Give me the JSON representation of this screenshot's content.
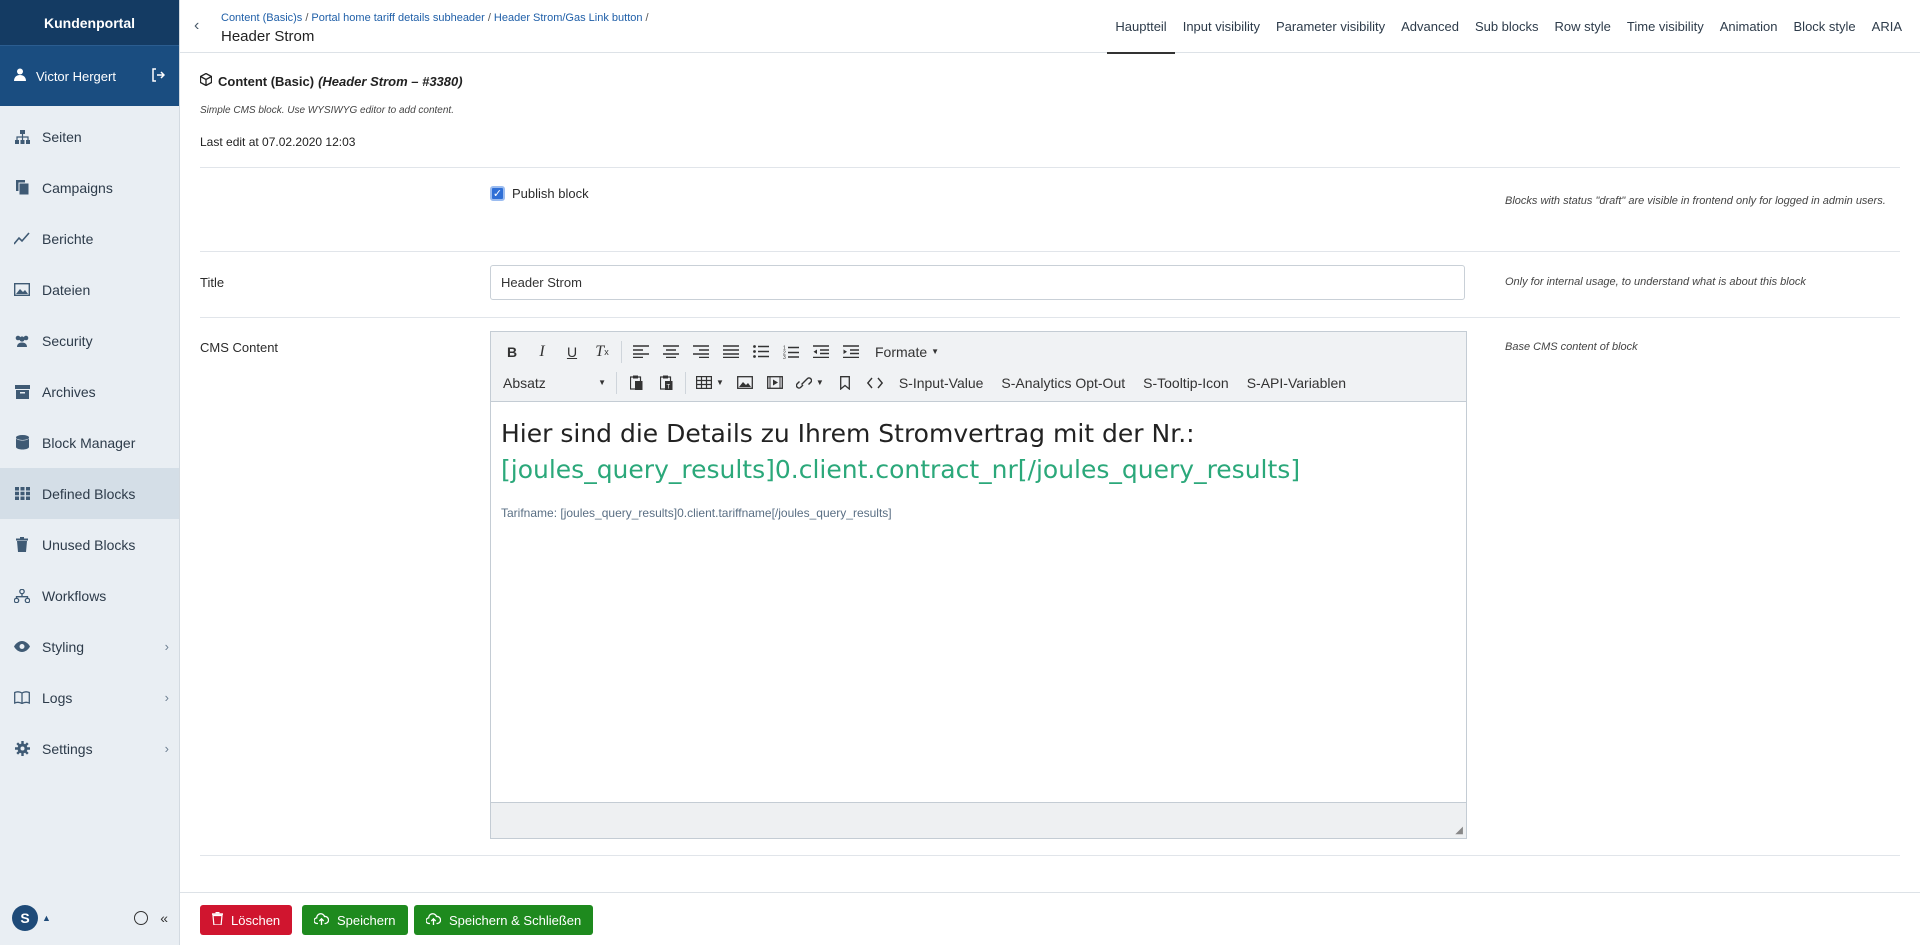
{
  "sidebar": {
    "brand": "Kundenportal",
    "user_name": "Victor Hergert",
    "items": [
      {
        "label": "Seiten",
        "icon": "sitemap-icon"
      },
      {
        "label": "Campaigns",
        "icon": "copy-icon"
      },
      {
        "label": "Berichte",
        "icon": "chart-line-icon"
      },
      {
        "label": "Dateien",
        "icon": "image-icon"
      },
      {
        "label": "Security",
        "icon": "users-icon"
      },
      {
        "label": "Archives",
        "icon": "archive-icon"
      },
      {
        "label": "Block Manager",
        "icon": "database-icon"
      },
      {
        "label": "Defined Blocks",
        "icon": "grid-icon"
      },
      {
        "label": "Unused Blocks",
        "icon": "trash-icon"
      },
      {
        "label": "Workflows",
        "icon": "workflow-icon"
      },
      {
        "label": "Styling",
        "icon": "eye-icon"
      },
      {
        "label": "Logs",
        "icon": "book-icon"
      },
      {
        "label": "Settings",
        "icon": "gear-icon"
      }
    ],
    "active_item": "Defined Blocks"
  },
  "header": {
    "breadcrumbs": [
      "Content (Basic)s",
      "Portal home tariff details subheader",
      "Header Strom/Gas Link button"
    ],
    "title": "Header Strom",
    "tabs": [
      "Hauptteil",
      "Input visibility",
      "Parameter visibility",
      "Advanced",
      "Sub blocks",
      "Row style",
      "Time visibility",
      "Animation",
      "Block style",
      "ARIA"
    ],
    "active_tab": "Hauptteil"
  },
  "main": {
    "block_type": "Content (Basic)",
    "block_sub": "(Header Strom – #3380)",
    "description": "Simple CMS block. Use WYSIWYG editor to add content.",
    "last_edit": "Last edit at 07.02.2020 12:03",
    "publish_label": "Publish block",
    "publish_help": "Blocks with status \"draft\" are visible in frontend only for logged in admin users.",
    "title_label": "Title",
    "title_value": "Header Strom",
    "title_help": "Only for internal usage, to understand what is about this block",
    "cms_label": "CMS Content",
    "cms_help": "Base CMS content of block"
  },
  "editor": {
    "formate_label": "Formate",
    "paragraph_select": "Absatz",
    "custom_buttons": [
      "S-Input-Value",
      "S-Analytics Opt-Out",
      "S-Tooltip-Icon",
      "S-API-Variablen"
    ],
    "heading_line1": "Hier sind die Details zu Ihrem Stromvertrag mit der Nr.:",
    "heading_line2": "[joules_query_results]0.client.contract_nr[/joules_query_results]",
    "tarif_line": "Tarifname: [joules_query_results]0.client.tariffname[/joules_query_results]"
  },
  "footer": {
    "delete_label": "Löschen",
    "save_label": "Speichern",
    "save_close_label": "Speichern & Schließen"
  },
  "colors": {
    "sidebar_header": "#143b63",
    "delete": "#d0152f",
    "save": "#1e8a1e",
    "heading_accent": "#2ba87a"
  }
}
